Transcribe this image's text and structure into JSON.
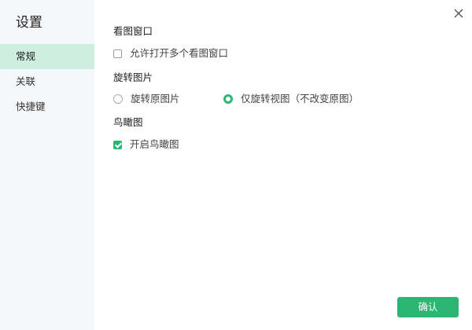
{
  "sidebar": {
    "title": "设置",
    "items": [
      {
        "label": "常规",
        "active": true
      },
      {
        "label": "关联",
        "active": false
      },
      {
        "label": "快捷键",
        "active": false
      }
    ]
  },
  "sections": {
    "viewer_window": {
      "title": "看图窗口",
      "options": [
        {
          "label": "允许打开多个看图窗口",
          "checked": false
        }
      ]
    },
    "rotate_image": {
      "title": "旋转图片",
      "options": [
        {
          "label": "旋转原图片",
          "selected": false
        },
        {
          "label": "仅旋转视图（不改变原图）",
          "selected": true
        }
      ]
    },
    "overview": {
      "title": "鸟瞰图",
      "options": [
        {
          "label": "开启鸟瞰图",
          "checked": true
        }
      ]
    }
  },
  "footer": {
    "confirm_label": "确认"
  },
  "icons": {
    "close": "close-icon"
  },
  "colors": {
    "accent": "#2bb673",
    "sidebar_bg": "#f6f7f9",
    "active_item_bg": "#cdeee0"
  }
}
